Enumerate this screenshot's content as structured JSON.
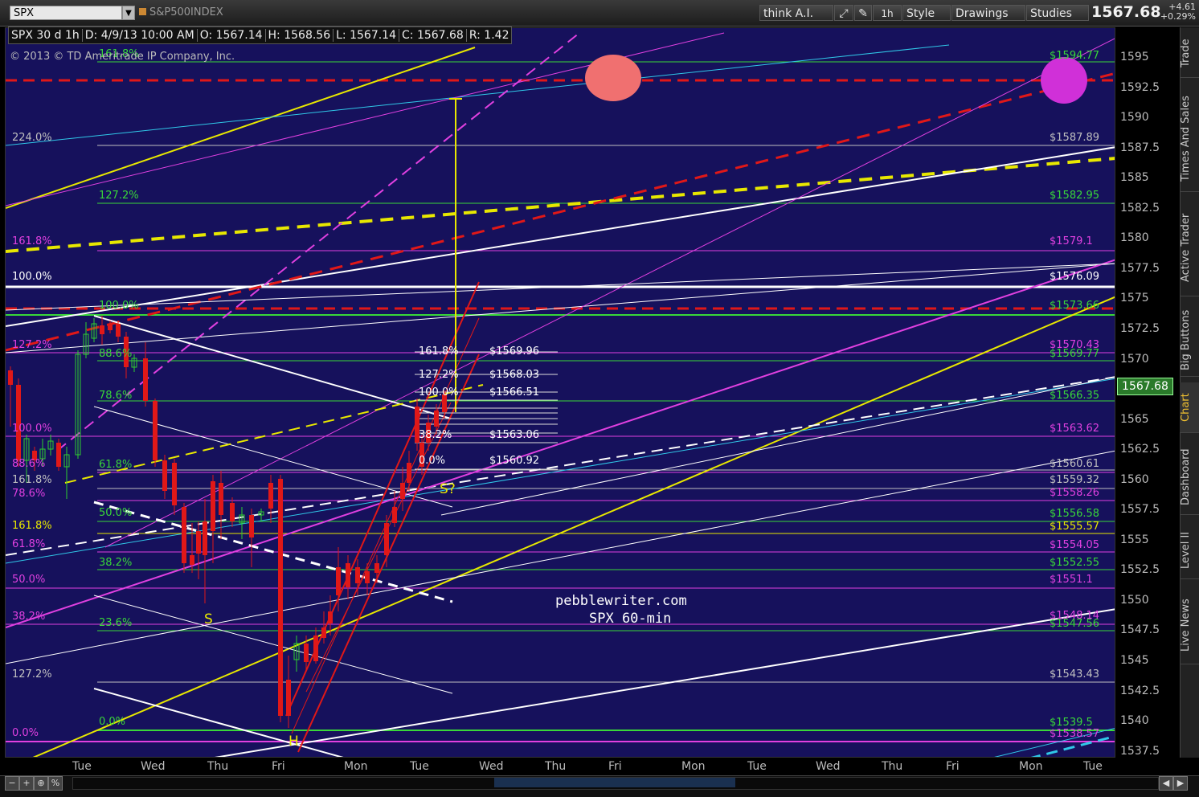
{
  "toolbar": {
    "symbol": "SPX",
    "description": "S&P500INDEX",
    "think_ai": "think A.I.",
    "timeframe": "1h",
    "style": "Style",
    "drawings": "Drawings",
    "studies": "Studies",
    "last_price": "1567.68",
    "change": "+4.61",
    "change_pct": "+0.29%"
  },
  "info_bar": {
    "chart_label": "SPX 30 d 1h",
    "date": "D: 4/9/13 10:00 AM",
    "open": "O: 1567.14",
    "high": "H: 1568.56",
    "low": "L: 1567.14",
    "close": "C: 1567.68",
    "range": "R: 1.42"
  },
  "copyright": "© 2013 © TD Ameritrade IP Company, Inc.",
  "watermark": {
    "line1": "pebblewriter.com",
    "line2": "SPX 60-min"
  },
  "current_price_tag": "1567.68",
  "y_axis_ticks": [
    "1595",
    "1592.5",
    "1590",
    "1587.5",
    "1585",
    "1582.5",
    "1580",
    "1577.5",
    "1575",
    "1572.5",
    "1570",
    "1567.5",
    "1565",
    "1562.5",
    "1560",
    "1557.5",
    "1555",
    "1552.5",
    "1550",
    "1547.5",
    "1545",
    "1542.5",
    "1540",
    "1537.5"
  ],
  "x_axis_ticks": [
    "Tue",
    "Wed",
    "Thu",
    "Fri",
    "Mon",
    "Tue",
    "Wed",
    "Thu",
    "Fri",
    "Mon",
    "Tue",
    "Wed",
    "Thu",
    "Fri",
    "Mon",
    "Tue"
  ],
  "sidebar_tabs": [
    "Trade",
    "Times And Sales",
    "Active Trader",
    "Big Buttons",
    "Chart",
    "Dashboard",
    "Level II",
    "Live News"
  ],
  "fib_right_labels": [
    {
      "text": "$1594.77",
      "color": "#39d739"
    },
    {
      "text": "$1587.89",
      "color": "#c0c0c0"
    },
    {
      "text": "$1582.95",
      "color": "#39d739"
    },
    {
      "text": "$1579.1",
      "color": "#e040e0"
    },
    {
      "text": "$1576.09",
      "color": "#ffffff"
    },
    {
      "text": "$1573.66",
      "color": "#39d739"
    },
    {
      "text": "$1570.43",
      "color": "#e040e0"
    },
    {
      "text": "$1569.77",
      "color": "#39d739"
    },
    {
      "text": "$1566.35",
      "color": "#39d739"
    },
    {
      "text": "$1563.62",
      "color": "#e040e0"
    },
    {
      "text": "$1560.61",
      "color": "#c0c0c0"
    },
    {
      "text": "$1559.32",
      "color": "#c0c0c0"
    },
    {
      "text": "$1558.26",
      "color": "#e040e0"
    },
    {
      "text": "$1556.58",
      "color": "#39d739"
    },
    {
      "text": "$1555.57",
      "color": "#e8e800"
    },
    {
      "text": "$1554.05",
      "color": "#e040e0"
    },
    {
      "text": "$1552.55",
      "color": "#39d739"
    },
    {
      "text": "$1551.1",
      "color": "#e040e0"
    },
    {
      "text": "$1548.14",
      "color": "#e040e0"
    },
    {
      "text": "$1547.56",
      "color": "#39d739"
    },
    {
      "text": "$1543.43",
      "color": "#c0c0c0"
    },
    {
      "text": "$1539.5",
      "color": "#39d739"
    },
    {
      "text": "$1538.57",
      "color": "#e040e0"
    }
  ],
  "fib_left_labels": [
    {
      "text": "161.8%",
      "color": "#39d739"
    },
    {
      "text": "224.0%",
      "color": "#c0c0c0"
    },
    {
      "text": "127.2%",
      "color": "#39d739"
    },
    {
      "text": "161.8%",
      "color": "#e040e0"
    },
    {
      "text": "100.0%",
      "color": "#ffffff"
    },
    {
      "text": "100.0%",
      "color": "#39d739"
    },
    {
      "text": "127.2%",
      "color": "#e040e0"
    },
    {
      "text": "88.6%",
      "color": "#39d739"
    },
    {
      "text": "78.6%",
      "color": "#39d739"
    },
    {
      "text": "100.0%",
      "color": "#e040e0"
    },
    {
      "text": "88.6%",
      "color": "#e040e0"
    },
    {
      "text": "61.8%",
      "color": "#39d739"
    },
    {
      "text": "161.8%",
      "color": "#c0c0c0"
    },
    {
      "text": "78.6%",
      "color": "#e040e0"
    },
    {
      "text": "50.0%",
      "color": "#39d739"
    },
    {
      "text": "161.8%",
      "color": "#e8e800"
    },
    {
      "text": "61.8%",
      "color": "#e040e0"
    },
    {
      "text": "38.2%",
      "color": "#39d739"
    },
    {
      "text": "50.0%",
      "color": "#e040e0"
    },
    {
      "text": "38.2%",
      "color": "#e040e0"
    },
    {
      "text": "23.6%",
      "color": "#39d739"
    },
    {
      "text": "127.2%",
      "color": "#c0c0c0"
    },
    {
      "text": "0.0%",
      "color": "#39d739"
    },
    {
      "text": "0.0%",
      "color": "#e040e0"
    }
  ],
  "fib_mid_labels": [
    {
      "pct": "161.8%",
      "price": "$1569.96"
    },
    {
      "pct": "127.2%",
      "price": "$1568.03"
    },
    {
      "pct": "100.0%",
      "price": "$1566.51"
    },
    {
      "pct": "38.2%",
      "price": "$1563.06"
    },
    {
      "pct": "0.0%",
      "price": "$1560.92"
    }
  ],
  "pattern_labels": {
    "s_left": "S",
    "head": "H",
    "s_right": "S?"
  },
  "colors": {
    "chart_bg": "#16115c",
    "up_candle": "#2fd02f",
    "down_candle": "#e01818",
    "accent_green": "#39d739",
    "accent_magenta": "#e040e0"
  }
}
